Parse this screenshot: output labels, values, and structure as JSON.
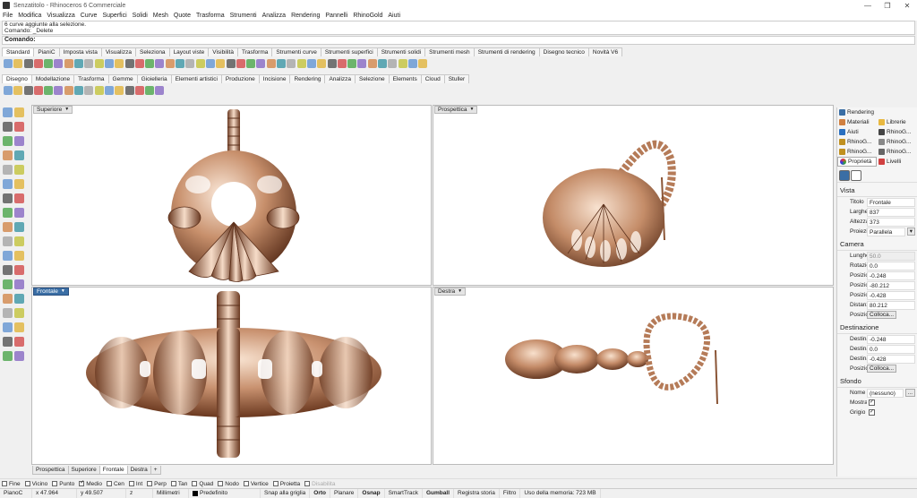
{
  "window": {
    "title": "Senzatitolo - Rhinoceros 6 Commerciale"
  },
  "menu": [
    "File",
    "Modifica",
    "Visualizza",
    "Curve",
    "Superfici",
    "Solidi",
    "Mesh",
    "Quote",
    "Trasforma",
    "Strumenti",
    "Analizza",
    "Rendering",
    "Pannelli",
    "RhinoGold",
    "Aiuti"
  ],
  "command": {
    "history_1": "6 curve aggiunte alla selezione.",
    "history_2": "Comando: _Delete",
    "prompt": "Comando:"
  },
  "toolbar_tabs_1": [
    "Standard",
    "PianiC",
    "Imposta vista",
    "Visualizza",
    "Seleziona",
    "Layout viste",
    "Visibilità",
    "Trasforma",
    "Strumenti curve",
    "Strumenti superfici",
    "Strumenti solidi",
    "Strumenti mesh",
    "Strumenti di rendering",
    "Disegno tecnico",
    "Novità V6"
  ],
  "toolbar_tabs_2": [
    "Disegno",
    "Modellazione",
    "Trasforma",
    "Gemme",
    "Gioielleria",
    "Elementi artistici",
    "Produzione",
    "Incisione",
    "Rendering",
    "Analizza",
    "Selezione",
    "Elements",
    "Cloud",
    "Stuller"
  ],
  "viewports": {
    "top_left": "Superiore",
    "top_right": "Prospettica",
    "bottom_left": "Frontale",
    "bottom_right": "Destra"
  },
  "viewport_tabs": [
    "Prospettica",
    "Superiore",
    "Frontale",
    "Destra",
    "+"
  ],
  "osnap": [
    {
      "label": "Fine",
      "checked": false
    },
    {
      "label": "Vicino",
      "checked": false
    },
    {
      "label": "Punto",
      "checked": false
    },
    {
      "label": "Medio",
      "checked": true
    },
    {
      "label": "Cen",
      "checked": false
    },
    {
      "label": "Int",
      "checked": false
    },
    {
      "label": "Perp",
      "checked": false
    },
    {
      "label": "Tan",
      "checked": false
    },
    {
      "label": "Quad",
      "checked": false
    },
    {
      "label": "Nodo",
      "checked": false
    },
    {
      "label": "Vertice",
      "checked": false
    },
    {
      "label": "Proietta",
      "checked": false
    },
    {
      "label": "Disabilita",
      "checked": false
    }
  ],
  "status": {
    "cplane": "PianoC",
    "x": "x 47.964",
    "y": "y 49.507",
    "z": "z",
    "units": "Millimetri",
    "layer": "Predefinito",
    "items": [
      "Snap alla griglia",
      "Orto",
      "Planare",
      "Osnap",
      "SmartTrack",
      "Gumball",
      "Registra storia",
      "Filtro",
      "Uso della memoria: 723 MB"
    ],
    "bold": [
      "Orto",
      "Osnap",
      "Gumball"
    ]
  },
  "panel": {
    "tabs": [
      "Rendering",
      "Materiali",
      "Librerie",
      "Aiuti",
      "RhinoG...",
      "RhinoG...",
      "RhinoG...",
      "RhinoG...",
      "RhinoG...",
      "Proprietà",
      "Livelli"
    ],
    "section_vista": "Vista",
    "vista": [
      {
        "k": "Titolo",
        "v": "Frontale"
      },
      {
        "k": "Larghezza",
        "v": "837"
      },
      {
        "k": "Altezza",
        "v": "373"
      },
      {
        "k": "Proiezione",
        "v": "Parallela"
      }
    ],
    "section_camera": "Camera",
    "camera": [
      {
        "k": "Lunghez...",
        "v": "50.0"
      },
      {
        "k": "Rotazione",
        "v": "0.0"
      },
      {
        "k": "Posizion...",
        "v": "-0.248"
      },
      {
        "k": "Posizion...",
        "v": "-80.212"
      },
      {
        "k": "Posizion...",
        "v": "-0.428"
      },
      {
        "k": "Distanza...",
        "v": "80.212"
      },
      {
        "k": "Posizione",
        "v": "Colloca..."
      }
    ],
    "section_dest": "Destinazione",
    "dest": [
      {
        "k": "Destinaz...",
        "v": "-0.248"
      },
      {
        "k": "Destinaz...",
        "v": "0.0"
      },
      {
        "k": "Destinaz...",
        "v": "-0.428"
      },
      {
        "k": "Posizione",
        "v": "Colloca..."
      }
    ],
    "section_sfondo": "Sfondo",
    "sfondo": [
      {
        "k": "Nome file",
        "v": "(nessuno)"
      },
      {
        "k": "Mostra",
        "v": "✓"
      },
      {
        "k": "Grigio",
        "v": "✓"
      }
    ]
  },
  "colors": {
    "metal_light": "#f3d9c4",
    "metal_mid": "#c98f6a",
    "metal_dark": "#6b3a22",
    "active_label": "#3a6ea5"
  }
}
